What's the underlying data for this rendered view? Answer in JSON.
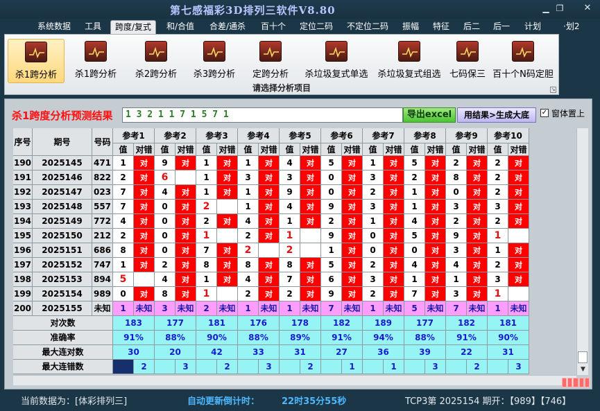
{
  "app": {
    "title": "第七感福彩3D排列三软件V8.80",
    "minimize_icon": "minimize-icon",
    "maximize_icon": "maximize-icon",
    "close_icon": "close-icon"
  },
  "menu": [
    "系统数据",
    "工具",
    "跨度/复式",
    "和/合值",
    "合差/通杀",
    "百十个",
    "定位二码",
    "不定位二码",
    "振幅",
    "特征",
    "后二",
    "后一",
    "计划",
    "·划2"
  ],
  "menu_active": "跨度/复式",
  "ribbon": {
    "buttons": [
      "杀1跨分析",
      "杀1跨分析",
      "杀2跨分析",
      "杀3跨分析",
      "定跨分析",
      "杀垃圾复式单选",
      "杀垃圾复式组选",
      "七码保三",
      "百十个N码定胆"
    ],
    "active_index": 0,
    "icon": "chart-icon",
    "group_label": "请选择分析项目"
  },
  "result": {
    "label": "杀1跨度分析预测结果",
    "value": "1 3 2 1 1 7 1 5 7 1",
    "excel_button": "导出excel",
    "generate_button": "用结果>生成大底",
    "pin_label": "窗体置上",
    "pin_checked": "✓"
  },
  "table": {
    "headers": {
      "seq": "序号",
      "issue": "期号",
      "number": "号码"
    },
    "refs": [
      "参考1",
      "参考2",
      "参考3",
      "参考4",
      "参考5",
      "参考6",
      "参考7",
      "参考8",
      "参考9",
      "参考10"
    ],
    "sub_value": "值",
    "sub_result": "对错",
    "hit_text": "对",
    "unknown_text": "未知",
    "rows": [
      {
        "seq": "190",
        "issue": "2025145",
        "number": "471",
        "vals": [
          "1",
          "9",
          "1",
          "1",
          "4",
          "5",
          "1",
          "5",
          "2",
          "2"
        ],
        "hits": [
          1,
          1,
          1,
          1,
          1,
          1,
          1,
          1,
          1,
          1
        ]
      },
      {
        "seq": "191",
        "issue": "2025146",
        "number": "822",
        "vals": [
          "2",
          "6",
          "1",
          "3",
          "3",
          "0",
          "3",
          "2",
          "8",
          "2"
        ],
        "hits": [
          1,
          0,
          1,
          1,
          1,
          1,
          1,
          1,
          1,
          1
        ]
      },
      {
        "seq": "192",
        "issue": "2025147",
        "number": "023",
        "vals": [
          "7",
          "4",
          "1",
          "1",
          "9",
          "0",
          "2",
          "1",
          "0",
          "2"
        ],
        "hits": [
          1,
          1,
          1,
          1,
          1,
          1,
          1,
          1,
          1,
          1
        ]
      },
      {
        "seq": "193",
        "issue": "2025148",
        "number": "557",
        "vals": [
          "7",
          "0",
          "2",
          "1",
          "4",
          "9",
          "3",
          "1",
          "3",
          "3"
        ],
        "hits": [
          1,
          1,
          0,
          1,
          1,
          1,
          1,
          1,
          1,
          1
        ]
      },
      {
        "seq": "194",
        "issue": "2025149",
        "number": "772",
        "vals": [
          "4",
          "0",
          "2",
          "4",
          "1",
          "2",
          "1",
          "4",
          "2",
          "2"
        ],
        "hits": [
          1,
          1,
          1,
          1,
          1,
          1,
          1,
          1,
          1,
          1
        ]
      },
      {
        "seq": "195",
        "issue": "2025150",
        "number": "212",
        "vals": [
          "2",
          "0",
          "1",
          "2",
          "1",
          "9",
          "0",
          "5",
          "9",
          "1"
        ],
        "hits": [
          1,
          1,
          0,
          1,
          0,
          1,
          1,
          1,
          1,
          0
        ]
      },
      {
        "seq": "196",
        "issue": "2025151",
        "number": "686",
        "vals": [
          "8",
          "0",
          "7",
          "2",
          "2",
          "1",
          "0",
          "0",
          "3",
          "1"
        ],
        "hits": [
          1,
          1,
          1,
          0,
          0,
          1,
          1,
          1,
          1,
          1
        ]
      },
      {
        "seq": "197",
        "issue": "2025152",
        "number": "747",
        "vals": [
          "1",
          "2",
          "8",
          "8",
          "8",
          "5",
          "2",
          "4",
          "4",
          "2"
        ],
        "hits": [
          1,
          1,
          1,
          1,
          1,
          1,
          1,
          1,
          1,
          1
        ]
      },
      {
        "seq": "198",
        "issue": "2025153",
        "number": "894",
        "vals": [
          "5",
          "4",
          "1",
          "4",
          "7",
          "6",
          "3",
          "1",
          "1",
          "3"
        ],
        "hits": [
          0,
          1,
          1,
          1,
          1,
          1,
          1,
          1,
          1,
          1
        ]
      },
      {
        "seq": "199",
        "issue": "2025154",
        "number": "989",
        "vals": [
          "0",
          "8",
          "1",
          "2",
          "2",
          "9",
          "2",
          "7",
          "3",
          "1"
        ],
        "hits": [
          1,
          1,
          0,
          1,
          1,
          1,
          1,
          1,
          1,
          0
        ]
      }
    ],
    "red_values": [
      [
        1,
        1
      ],
      [
        3,
        2
      ],
      [
        5,
        2
      ],
      [
        5,
        4
      ],
      [
        5,
        9
      ],
      [
        6,
        3
      ],
      [
        6,
        4
      ],
      [
        8,
        0
      ],
      [
        9,
        2
      ],
      [
        9,
        9
      ]
    ],
    "predict": {
      "seq": "200",
      "issue": "2025155",
      "number": "未知",
      "vals": [
        "1",
        "3",
        "2",
        "1",
        "1",
        "7",
        "1",
        "5",
        "7",
        "1"
      ]
    },
    "stats": [
      {
        "label": "对次数",
        "values": [
          "183",
          "177",
          "181",
          "176",
          "178",
          "182",
          "189",
          "177",
          "182",
          "181"
        ]
      },
      {
        "label": "准确率",
        "values": [
          "91%",
          "88%",
          "90%",
          "88%",
          "89%",
          "91%",
          "94%",
          "88%",
          "91%",
          "90%"
        ]
      },
      {
        "label": "最大连对数",
        "values": [
          "30",
          "20",
          "42",
          "33",
          "31",
          "27",
          "36",
          "39",
          "22",
          "31"
        ]
      },
      {
        "label": "最大连错数",
        "values": [
          "2",
          "3",
          "2",
          "3",
          "2",
          "1",
          "1",
          "3",
          "2",
          "3"
        ]
      }
    ]
  },
  "status": {
    "current_data": "当前数据为：[体彩排列三]",
    "countdown_label": "自动更新倒计时：",
    "countdown_value": "22时35分55秒",
    "issue_info": "TCP3第 2025154 期开：【989】【746】"
  }
}
